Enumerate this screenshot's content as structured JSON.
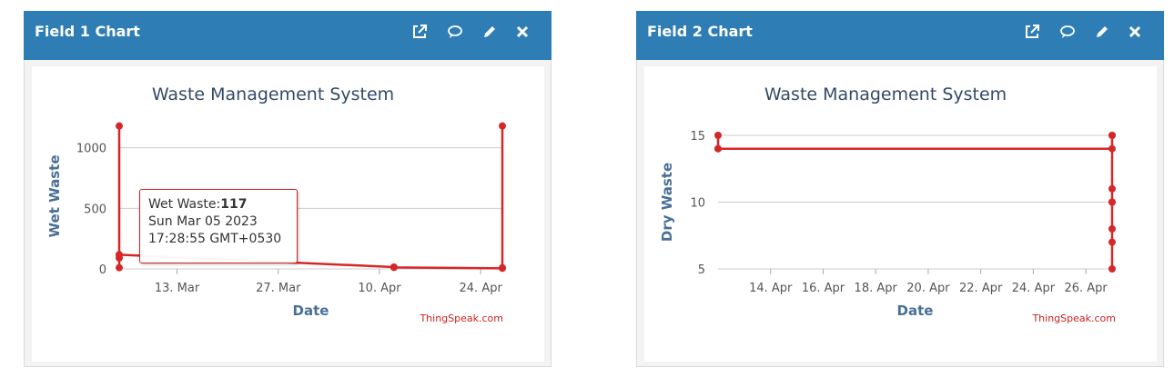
{
  "widgets": [
    {
      "title": "Field 1 Chart",
      "icons": [
        "external-link-icon",
        "comment-icon",
        "pencil-icon",
        "close-icon"
      ],
      "credit": "ThingSpeak.com",
      "tooltip": {
        "series_label": "Wet Waste:",
        "value": "117",
        "date": "Sun Mar 05 2023",
        "time": "17:28:55 GMT+0530"
      }
    },
    {
      "title": "Field 2 Chart",
      "icons": [
        "external-link-icon",
        "comment-icon",
        "pencil-icon",
        "close-icon"
      ],
      "credit": "ThingSpeak.com"
    }
  ],
  "colors": {
    "header": "#2e7db5",
    "series": "#d62728",
    "axis_title": "#4a6f96",
    "title": "#334a66",
    "credit": "#cc2222"
  },
  "chart_data": [
    {
      "type": "line",
      "title": "Waste Management System",
      "xlabel": "Date",
      "ylabel": "Wet Waste",
      "xlim": [
        "2023-03-05",
        "2023-04-27"
      ],
      "ylim": [
        0,
        1200
      ],
      "yticks": [
        0,
        500,
        1000
      ],
      "xticks": [
        {
          "date": "2023-03-13",
          "label": "13. Mar"
        },
        {
          "date": "2023-03-27",
          "label": "27. Mar"
        },
        {
          "date": "2023-04-10",
          "label": "10. Apr"
        },
        {
          "date": "2023-04-24",
          "label": "24. Apr"
        }
      ],
      "grid": true,
      "series": [
        {
          "x": [
            "2023-03-05",
            "2023-03-05",
            "2023-03-05",
            "2023-03-05",
            "2023-03-05",
            "2023-04-12",
            "2023-04-12",
            "2023-04-27",
            "2023-04-27",
            "2023-04-27"
          ],
          "y": [
            1180,
            10,
            90,
            117,
            117,
            15,
            12,
            5,
            10,
            1180
          ]
        }
      ]
    },
    {
      "type": "line",
      "title": "Waste Management System",
      "xlabel": "Date",
      "ylabel": "Dry Waste",
      "xlim": [
        "2023-04-12",
        "2023-04-27"
      ],
      "ylim": [
        5,
        15
      ],
      "yticks": [
        5,
        10,
        15
      ],
      "xticks": [
        {
          "date": "2023-04-14",
          "label": "14. Apr"
        },
        {
          "date": "2023-04-16",
          "label": "16. Apr"
        },
        {
          "date": "2023-04-18",
          "label": "18. Apr"
        },
        {
          "date": "2023-04-20",
          "label": "20. Apr"
        },
        {
          "date": "2023-04-22",
          "label": "22. Apr"
        },
        {
          "date": "2023-04-24",
          "label": "24. Apr"
        },
        {
          "date": "2023-04-26",
          "label": "26. Apr"
        }
      ],
      "grid": true,
      "series": [
        {
          "x": [
            "2023-04-12",
            "2023-04-12",
            "2023-04-12",
            "2023-04-27",
            "2023-04-27",
            "2023-04-27",
            "2023-04-27",
            "2023-04-27",
            "2023-04-27",
            "2023-04-27",
            "2023-04-27",
            "2023-04-27"
          ],
          "y": [
            15,
            14,
            14,
            14,
            15,
            15,
            11,
            10,
            10,
            8,
            7,
            5
          ]
        }
      ]
    }
  ]
}
